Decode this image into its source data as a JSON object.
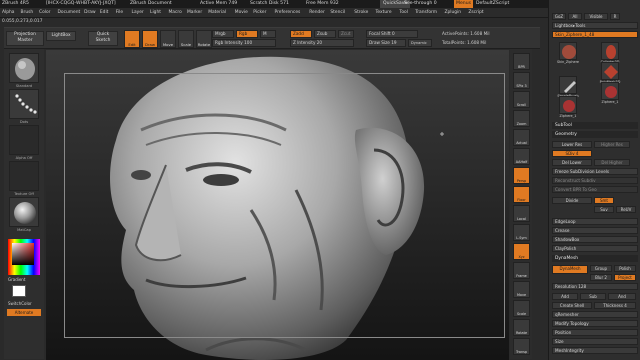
{
  "title_bar": {
    "app": "ZBrush 4R5",
    "doc": "[IHCX-CQGQ-WHBT-AKYJ-JXQT]",
    "document": "ZBrush Document",
    "active_mem": "Active Mem 749",
    "scratch_disk": "Scratch Disk 571",
    "free_mem": "Free Mem 932",
    "quicksave": "QuickSave",
    "see_through": "See-through 0",
    "menus": "Menus",
    "default_zscript": "DefaultZScript"
  },
  "menu_bar": {
    "items": [
      "Alpha",
      "Brush",
      "Color",
      "Document",
      "Draw",
      "Edit",
      "File",
      "Layer",
      "Light",
      "Macro",
      "Marker",
      "Material",
      "Movie",
      "Picker",
      "Preferences",
      "Render",
      "Stencil",
      "Stroke",
      "Texture",
      "Tool",
      "Transform",
      "Zplugin",
      "Zscript"
    ]
  },
  "coords": "0.055,0.273,0.017",
  "top_shelf": {
    "projection_master": "Projection Master",
    "lightbox": "LightBox",
    "quick_sketch": "Quick Sketch",
    "tools": [
      {
        "label": "Edit",
        "on": true
      },
      {
        "label": "Draw",
        "on": true
      },
      {
        "label": "Move",
        "on": false
      },
      {
        "label": "Scale",
        "on": false
      },
      {
        "label": "Rotate",
        "on": false
      }
    ],
    "mrgb": "Mrgb",
    "rgb": "Rgb",
    "m": "M",
    "rgb_intensity": "Rgb Intensity 100",
    "zadd": "Zadd",
    "zsub": "Zsub",
    "zcut": "Zcut",
    "z_intensity": "Z Intensity 20",
    "focal_shift": "Focal Shift 0",
    "draw_size": "Draw Size 19",
    "dynamic": "Dynamic",
    "active_points": "ActivePoints: 1.608 Mil",
    "total_points": "TotalPoints: 1.608 Mil"
  },
  "left_shelf": {
    "thumbs": [
      "Standard",
      "Dots",
      "Alpha Off",
      "Texture Off",
      "MatCap"
    ],
    "gradient": "Gradient",
    "switch_color": "SwitchColor",
    "alternate": "Alternate"
  },
  "right_shelf": {
    "buttons": [
      {
        "label": "BPR",
        "on": false
      },
      {
        "label": "SPix 3",
        "on": false
      },
      {
        "label": "Scroll",
        "on": false
      },
      {
        "label": "Zoom",
        "on": false
      },
      {
        "label": "Actual",
        "on": false
      },
      {
        "label": "AAHalf",
        "on": false
      },
      {
        "label": "Persp",
        "on": true
      },
      {
        "label": "Floor",
        "on": true
      },
      {
        "label": "Local",
        "on": false
      },
      {
        "label": "L.Sym",
        "on": false
      },
      {
        "label": "Xyz",
        "on": true
      },
      {
        "label": "Frame",
        "on": false
      },
      {
        "label": "Move",
        "on": false
      },
      {
        "label": "Scale",
        "on": false
      },
      {
        "label": "Rotate",
        "on": false
      },
      {
        "label": "Transp",
        "on": false
      }
    ]
  },
  "right_panel": {
    "top_buttons": [
      "GoZ",
      "All",
      "Visible",
      "R"
    ],
    "lightbox_tools": "Lightbox▸Tools",
    "tool_name": "Skin_Ziphere_1_48",
    "tool_thumbs": [
      "Skin_Ziphere",
      "Cylinder3D",
      "PolyMesh3D",
      "SimpleBrush",
      "Ziphere_1",
      "Ziphere_1"
    ],
    "subtool": "SubTool",
    "geometry": "Geometry",
    "lower_res": "Lower Res",
    "higher_res": "Higher Res",
    "sdiv": "SDiv 4",
    "del_lower": "Del Lower",
    "del_higher": "Del Higher",
    "freeze_subdiv": "Freeze SubDivision Levels",
    "reconstruct_subdiv": "Reconstruct Subdiv",
    "convert_bpr": "Convert BPR To Geo",
    "divide": "Divide",
    "smt": "Smt",
    "suv": "Suv",
    "reuv": "ReUV",
    "edge_loop": "EdgeLoop",
    "crease": "Crease",
    "shadow_box": "ShadowBox",
    "clay_polish": "ClayPolish",
    "dynamesh_section": "DynaMesh",
    "dynamesh": "DynaMesh",
    "group": "Group",
    "polish": "Polish",
    "blur": "Blur 2",
    "project": "Project",
    "resolution": "Resolution 128",
    "add": "Add",
    "sub": "Sub",
    "and": "And",
    "create_shell": "Create Shell",
    "thickness": "Thickness 4",
    "qremesher": "qRemesher",
    "modify_topology": "Modify Topology",
    "position": "Position",
    "size": "Size",
    "mesh_integrity": "MeshIntegrity"
  },
  "colors": {
    "accent": "#e07a22",
    "panel": "#2e2e2e",
    "canvas_bg": "#1d1d1d"
  }
}
